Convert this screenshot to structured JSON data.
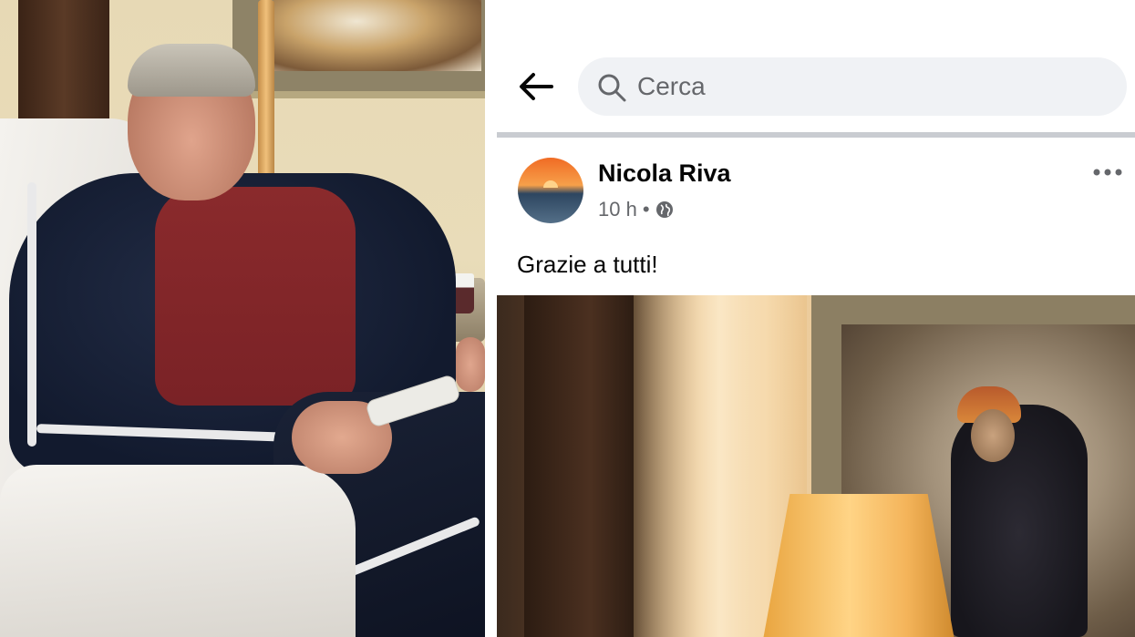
{
  "search": {
    "placeholder": "Cerca",
    "back_icon": "arrow-left-icon",
    "search_icon": "magnifier-icon"
  },
  "post": {
    "author": "Nicola Riva",
    "time": "10 h",
    "separator": "•",
    "audience_icon": "globe-icon",
    "more_icon": "more-horizontal-icon",
    "text": "Grazie a tutti!"
  },
  "colors": {
    "search_bg": "#f0f2f5",
    "text_primary": "#050505",
    "text_secondary": "#65676b",
    "divider": "#c9ccd1"
  }
}
